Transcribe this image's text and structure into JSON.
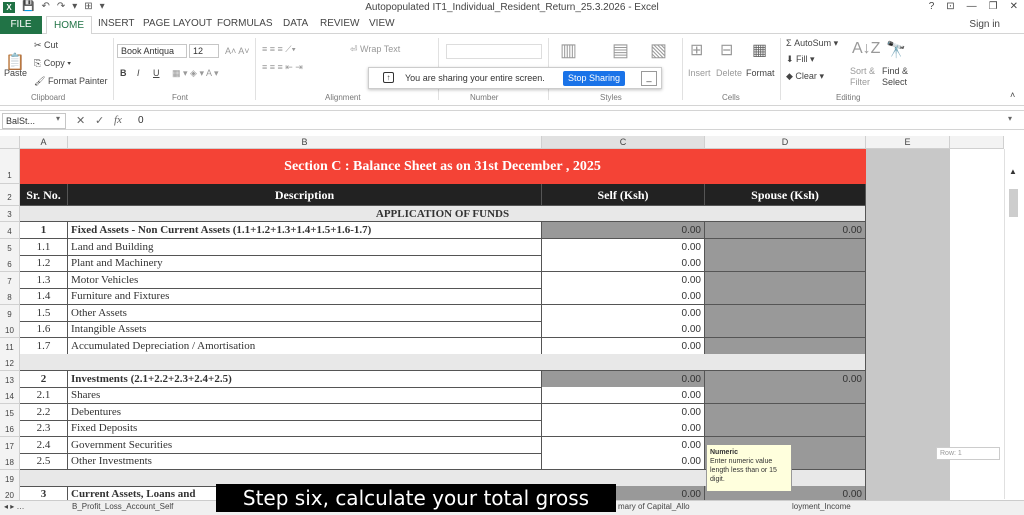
{
  "titlebar": {
    "logo": "X",
    "qat": [
      "💾",
      "↶",
      "↷",
      "▾",
      "⊞",
      "▾"
    ],
    "title": "Autopopulated IT1_Individual_Resident_Return_25.3.2026 - Excel",
    "controls": [
      "?",
      "⊡",
      "—",
      "❐",
      "✕"
    ]
  },
  "tabs": {
    "file": "FILE",
    "items": [
      "HOME",
      "INSERT",
      "PAGE LAYOUT",
      "FORMULAS",
      "DATA",
      "REVIEW",
      "VIEW"
    ],
    "signin": "Sign in"
  },
  "ribbon": {
    "paste": "Paste",
    "cut": "Cut",
    "copy": "Copy",
    "format_painter": "Format Painter",
    "clipboard": "Clipboard",
    "font_name": "Book Antiqua",
    "font_size": "12",
    "font": "Font",
    "bold": "B",
    "italic": "I",
    "underline": "U",
    "wrap_text": "Wrap Text",
    "alignment": "Alignment",
    "number": "Number",
    "styles": "Styles",
    "insert": "Insert",
    "delete": "Delete",
    "format": "Format",
    "cells": "Cells",
    "autosum": "AutoSum",
    "fill": "Fill",
    "clear": "Clear",
    "sort_filter": "Sort & Filter",
    "find_select": "Find & Select",
    "editing": "Editing"
  },
  "share": {
    "message": "You are sharing your entire screen.",
    "stop": "Stop Sharing",
    "minimize": "_"
  },
  "formula": {
    "namebox": "BalSt...",
    "fx": "fx",
    "value": "0"
  },
  "columns": [
    "A",
    "B",
    "C",
    "D",
    "E"
  ],
  "sheet": {
    "section_title": "Section C : Balance Sheet as on 31st December , 2025",
    "hdr_sr": "Sr. No.",
    "hdr_desc": "Description",
    "hdr_self": "Self (Ksh)",
    "hdr_spouse": "Spouse (Ksh)",
    "application": "APPLICATION OF FUNDS",
    "rows": [
      {
        "rn": "4",
        "sr": "1",
        "desc": "Fixed Assets - Non Current Assets (1.1+1.2+1.3+1.4+1.5+1.6-1.7)",
        "self": "0.00",
        "spouse": "0.00",
        "bold": true
      },
      {
        "rn": "5",
        "sr": "1.1",
        "desc": "Land and Building",
        "self": "0.00",
        "spouse": ""
      },
      {
        "rn": "6",
        "sr": "1.2",
        "desc": "Plant and Machinery",
        "self": "0.00",
        "spouse": ""
      },
      {
        "rn": "7",
        "sr": "1.3",
        "desc": "Motor Vehicles",
        "self": "0.00",
        "spouse": ""
      },
      {
        "rn": "8",
        "sr": "1.4",
        "desc": "Furniture and Fixtures",
        "self": "0.00",
        "spouse": ""
      },
      {
        "rn": "9",
        "sr": "1.5",
        "desc": "Other Assets",
        "self": "0.00",
        "spouse": ""
      },
      {
        "rn": "10",
        "sr": "1.6",
        "desc": "Intangible Assets",
        "self": "0.00",
        "spouse": ""
      },
      {
        "rn": "11",
        "sr": "1.7",
        "desc": "Accumulated Depreciation / Amortisation",
        "self": "0.00",
        "spouse": ""
      },
      {
        "rn": "12",
        "sr": "",
        "desc": "",
        "self": "",
        "spouse": "",
        "blank": true
      },
      {
        "rn": "13",
        "sr": "2",
        "desc": "Investments (2.1+2.2+2.3+2.4+2.5)",
        "self": "0.00",
        "spouse": "0.00",
        "bold": true
      },
      {
        "rn": "14",
        "sr": "2.1",
        "desc": "Shares",
        "self": "0.00",
        "spouse": ""
      },
      {
        "rn": "15",
        "sr": "2.2",
        "desc": "Debentures",
        "self": "0.00",
        "spouse": ""
      },
      {
        "rn": "16",
        "sr": "2.3",
        "desc": "Fixed Deposits",
        "self": "0.00",
        "spouse": ""
      },
      {
        "rn": "17",
        "sr": "2.4",
        "desc": "Government Securities",
        "self": "0.00",
        "spouse": ""
      },
      {
        "rn": "18",
        "sr": "2.5",
        "desc": "Other Investments",
        "self": "0.00",
        "spouse": ""
      },
      {
        "rn": "19",
        "sr": "",
        "desc": "",
        "self": "",
        "spouse": "",
        "blank": true
      },
      {
        "rn": "20",
        "sr": "3",
        "desc": "Current Assets, Loans and",
        "self": "0.00",
        "spouse": "0.00",
        "bold": true
      }
    ]
  },
  "tooltip": {
    "title": "Numeric",
    "body": "Enter numeric value length less than or 15 digit."
  },
  "side_box": "Row: 1",
  "sheet_tabs": [
    "B_Profit_Loss_Account_Self",
    "mary of Capital_Allo",
    "loyment_Income"
  ],
  "caption": "Step six, calculate your total gross",
  "colors": {
    "excel_green": "#217346",
    "section_red": "#f44336",
    "header_dark": "#222222",
    "share_blue": "#1a73e8"
  }
}
